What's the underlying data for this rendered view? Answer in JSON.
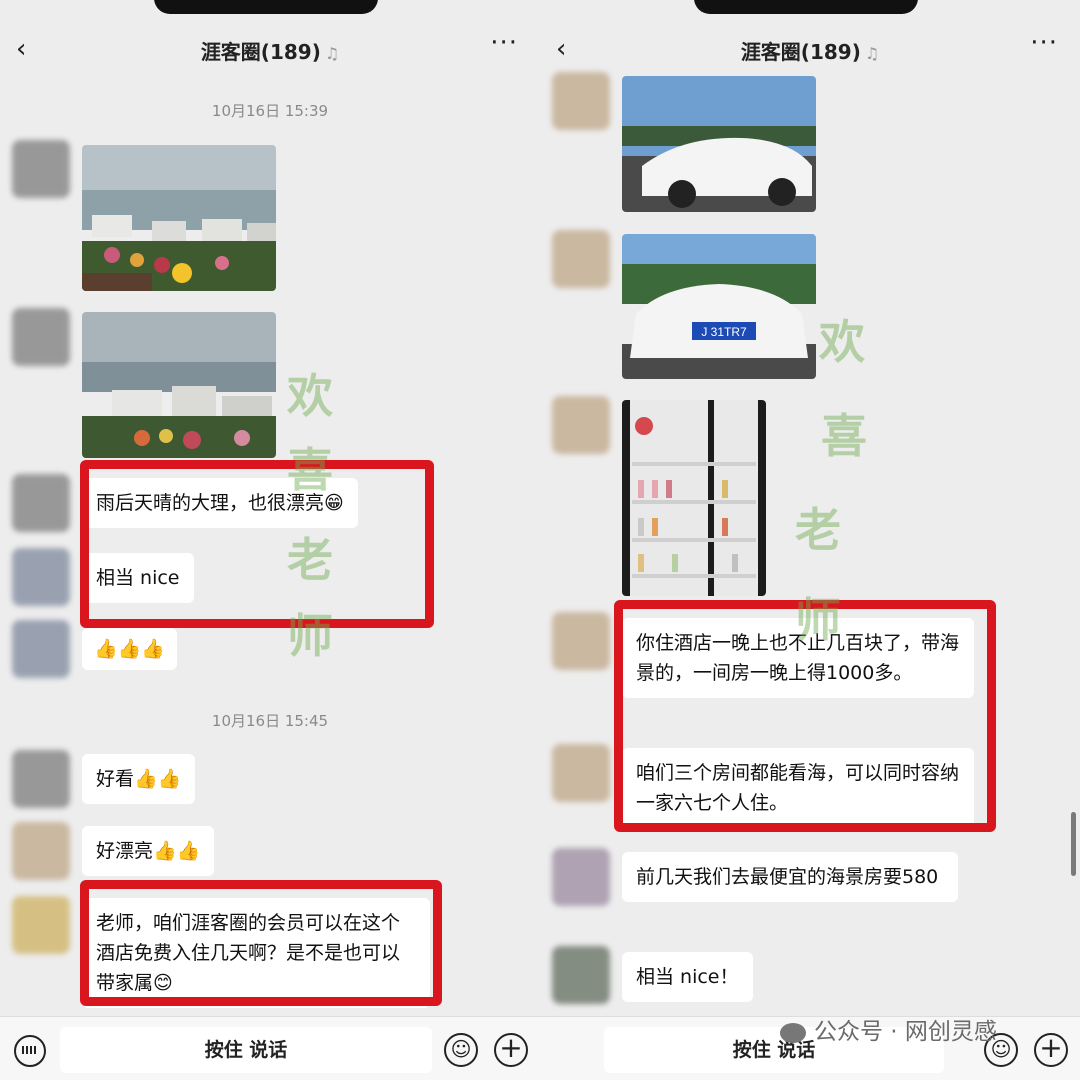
{
  "chat": {
    "title": "涯客圈(189)",
    "left": {
      "time1": "10月16日 15:39",
      "time2": "10月16日 15:45",
      "msg1": "雨后天晴的大理，也很漂亮😁",
      "msg2": "相当 nice",
      "msg3": "👍👍👍",
      "msg4": "好看👍👍",
      "msg5": "好漂亮👍👍",
      "msg6": "老师，咱们涯客圈的会员可以在这个酒店免费入住几天啊？是不是也可以带家属😊"
    },
    "right": {
      "msg1": "你住酒店一晚上也不止几百块了，带海景的，一间房一晚上得1000多。",
      "msg2": "咱们三个房间都能看海，可以同时容纳一家六七个人住。",
      "msg3": "前几天我们去最便宜的海景房要580",
      "msg4": "相当 nice！",
      "plate": "J 31TR7"
    }
  },
  "toolbar": {
    "talk_label": "按住 说话"
  },
  "watermark": {
    "c1": "欢",
    "c2": "喜",
    "c3": "老",
    "c4": "师"
  },
  "brand": {
    "text": "公众号 · 网创灵感"
  },
  "icons": [
    "back-icon",
    "more-icon",
    "mute-icon",
    "keyboard-icon",
    "emoji-icon",
    "plus-icon"
  ],
  "colors": {
    "highlight": "#d9161d",
    "watermark": "#6eaa50",
    "background": "#ededed"
  }
}
